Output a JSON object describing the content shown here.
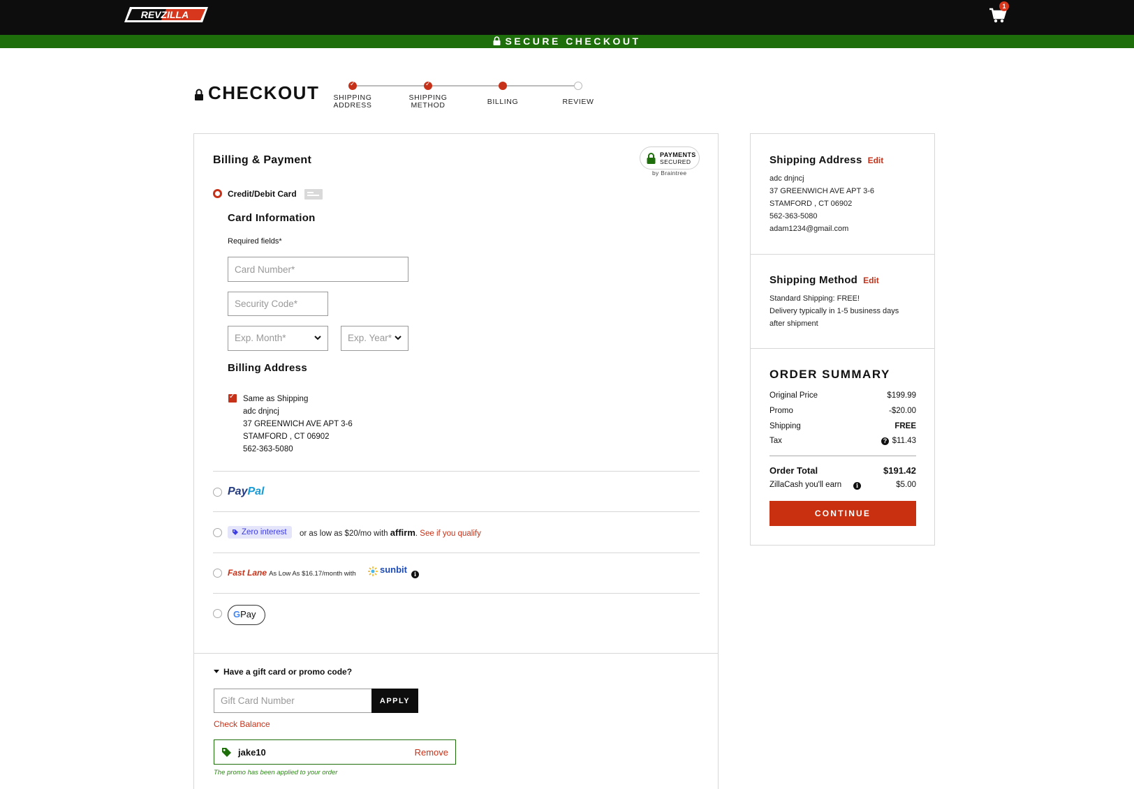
{
  "header": {
    "logo_text": "REVZILLA",
    "cart_count": "1",
    "secure_banner": "SECURE CHECKOUT"
  },
  "checkout": {
    "title": "CHECKOUT",
    "steps": [
      {
        "label": "SHIPPING\nADDRESS",
        "state": "done"
      },
      {
        "label": "SHIPPING\nMETHOD",
        "state": "done"
      },
      {
        "label": "BILLING",
        "state": "current"
      },
      {
        "label": "REVIEW",
        "state": "upcoming"
      }
    ]
  },
  "billing": {
    "heading": "Billing & Payment",
    "braintree_line1": "PAYMENTS",
    "braintree_line2": "SECURED",
    "braintree_by": "by Braintree",
    "credit_label": "Credit/Debit Card",
    "card_info_heading": "Card Information",
    "required_note": "Required fields*",
    "card_number_placeholder": "Card Number*",
    "security_code_placeholder": "Security Code*",
    "exp_month_placeholder": "Exp. Month*",
    "exp_year_placeholder": "Exp. Year*",
    "billing_address_heading": "Billing Address",
    "same_as_shipping_label": "Same as Shipping",
    "address_lines": [
      "adc dnjncj",
      "37 GREENWICH AVE APT 3-6",
      "STAMFORD , CT 06902",
      "562-363-5080"
    ]
  },
  "payment_options": {
    "paypal_pay": "Pay",
    "paypal_pal": "Pal",
    "zero_interest": "Zero interest",
    "affirm_prefix": "or as low as $20/mo with",
    "affirm_brand": "affirm",
    "affirm_qualify": "See if you qualify",
    "fastlane_brand": "Fast Lane",
    "fastlane_text": "As Low As $16.17/month with",
    "sunbit_brand": "sunbit",
    "gpay_g": "G",
    "gpay_pay": "Pay"
  },
  "promo": {
    "toggle_label": "Have a gift card or promo code?",
    "gift_card_placeholder": "Gift Card Number",
    "apply_label": "APPLY",
    "check_balance": "Check Balance",
    "applied_code": "jake10",
    "remove_label": "Remove",
    "applied_note": "The promo has been applied to your order"
  },
  "sidebar": {
    "shipping_address_heading": "Shipping Address",
    "edit_label": "Edit",
    "shipping_address_lines": [
      "adc dnjncj",
      "37 GREENWICH AVE APT 3-6",
      "STAMFORD , CT 06902",
      "562-363-5080",
      "adam1234@gmail.com"
    ],
    "shipping_method_heading": "Shipping Method",
    "shipping_method_lines": [
      "Standard Shipping: FREE!",
      "Delivery typically in 1-5 business days",
      "after shipment"
    ],
    "order_summary_heading": "ORDER SUMMARY",
    "rows": [
      {
        "label": "Original Price",
        "value": "$199.99"
      },
      {
        "label": "Promo",
        "value": "-$20.00"
      },
      {
        "label": "Shipping",
        "value": "FREE"
      },
      {
        "label": "Tax",
        "value": "$11.43"
      }
    ],
    "order_total_label": "Order Total",
    "order_total_value": "$191.42",
    "zillacash_label": "ZillaCash you'll earn",
    "zillacash_value": "$5.00",
    "continue_label": "CONTINUE"
  },
  "colors": {
    "accent": "#c63219",
    "secure_green": "#1e6f0b",
    "header_bg": "#0d0d0d"
  }
}
